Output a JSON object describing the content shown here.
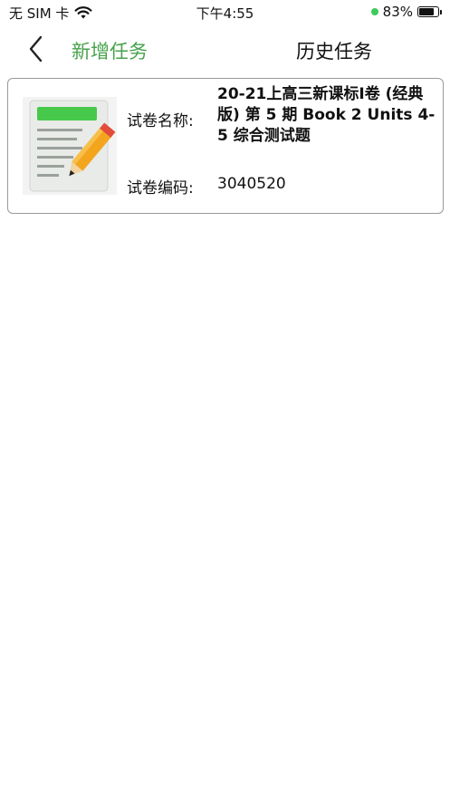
{
  "status_bar": {
    "carrier": "无 SIM 卡",
    "time": "下午4:55",
    "battery_percent": "83%",
    "battery_level": 0.83
  },
  "nav": {
    "new_task_label": "新增任务",
    "history_label": "历史任务",
    "accent_color": "#47a34d"
  },
  "task": {
    "name_label": "试卷名称:",
    "name_value": "20-21上高三新课标I卷 (经典版) 第 5 期 Book 2 Units 4-5 综合测试题",
    "code_label": "试卷编码:",
    "code_value": "3040520",
    "icon": "document-edit-icon"
  }
}
